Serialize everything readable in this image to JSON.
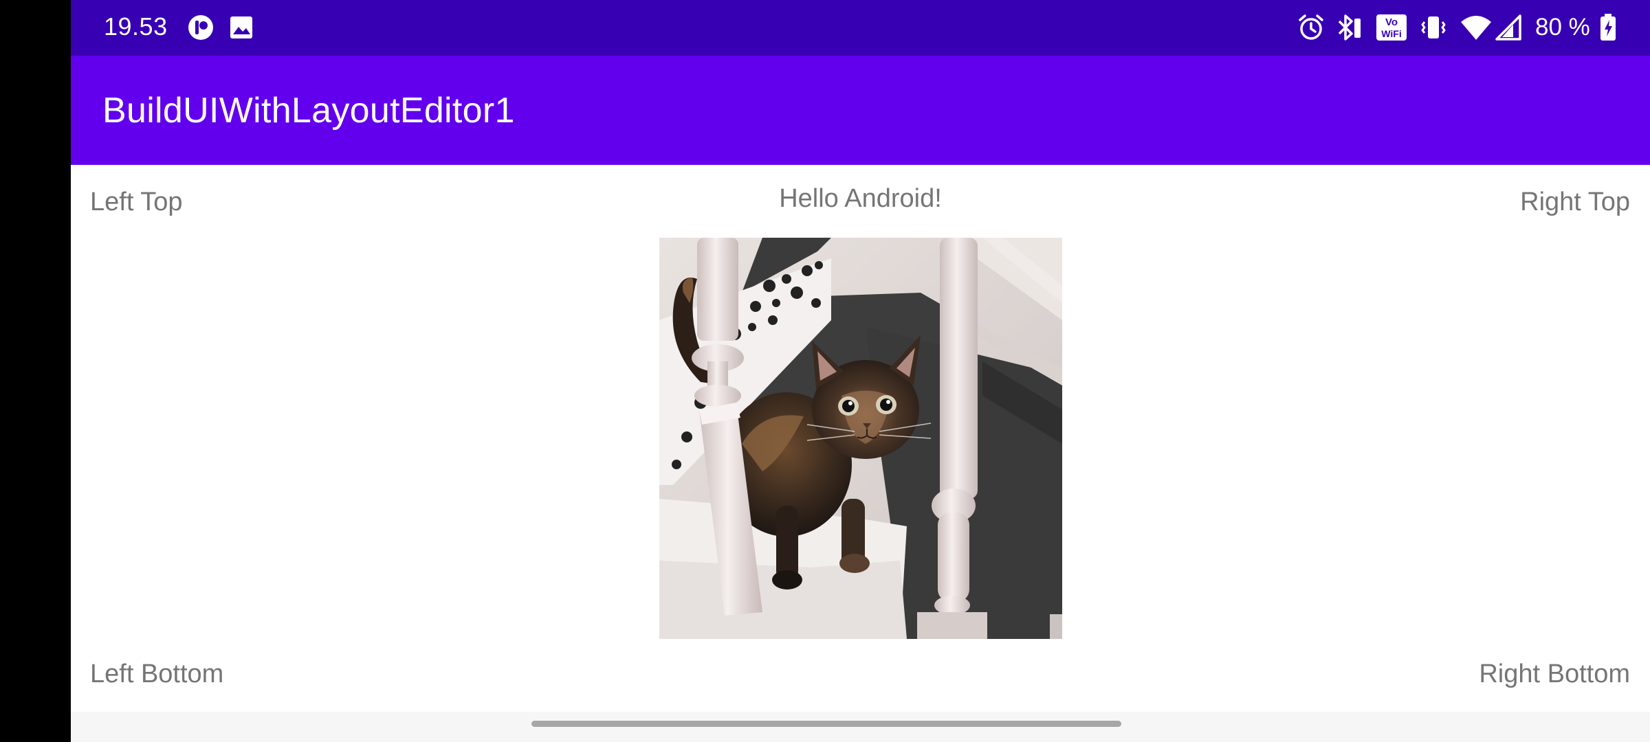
{
  "status_bar": {
    "time": "19.53",
    "battery_text": "80 %",
    "icons": [
      "app-notification-icon",
      "image-notification-icon",
      "alarm-icon",
      "bluetooth-icon",
      "vowifi-icon",
      "vibrate-icon",
      "wifi-icon",
      "cell-signal-icon",
      "battery-charging-icon"
    ],
    "vowifi_top": "Vo",
    "vowifi_bottom": "WiFi",
    "background": "#3700b3"
  },
  "app_bar": {
    "title": "BuildUIWithLayoutEditor1",
    "background": "#6200ee"
  },
  "labels": {
    "left_top": "Left Top",
    "center_top": "Hello Android!",
    "right_top": "Right Top",
    "left_bottom": "Left Bottom",
    "right_bottom": "Right Bottom"
  },
  "image": {
    "subject": "tortoiseshell kitten on stairs between white banisters"
  }
}
